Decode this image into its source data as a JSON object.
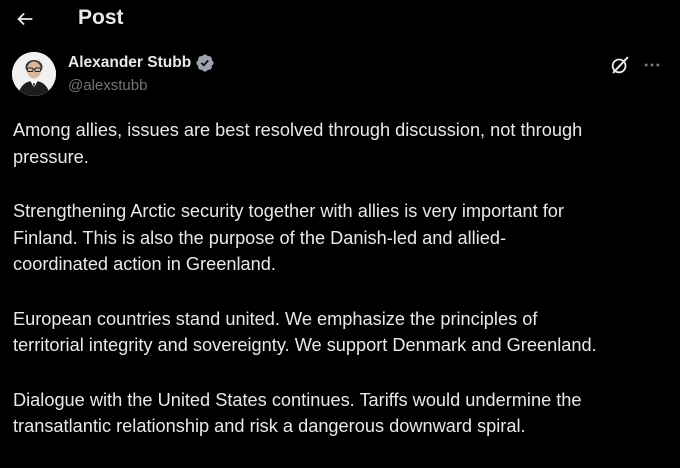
{
  "header": {
    "title": "Post",
    "back_icon": "arrow-left-icon"
  },
  "author": {
    "name": "Alexander Stubb",
    "handle": "@alexstubb",
    "verified_icon": "verified-badge-icon",
    "verified_color": "#9ca3af",
    "avatar_icon": "avatar-portrait"
  },
  "actions": {
    "grok_icon": "grok-icon",
    "more_icon": "more-horizontal-icon"
  },
  "post": {
    "paragraphs": [
      "Among allies, issues are best resolved through discussion, not through\npressure.",
      "Strengthening Arctic security together with allies is very important for\nFinland. This is also the purpose of the Danish-led and allied-\ncoordinated action in Greenland.",
      "European countries stand united. We emphasize the principles of\nterritorial integrity and sovereignty. We support Denmark and Greenland.",
      "Dialogue with the United States continues. Tariffs would undermine the\ntransatlantic relationship and risk a dangerous downward spiral."
    ]
  },
  "colors": {
    "background": "#000000",
    "text": "#e7e9ea",
    "secondary_text": "#71767b"
  }
}
